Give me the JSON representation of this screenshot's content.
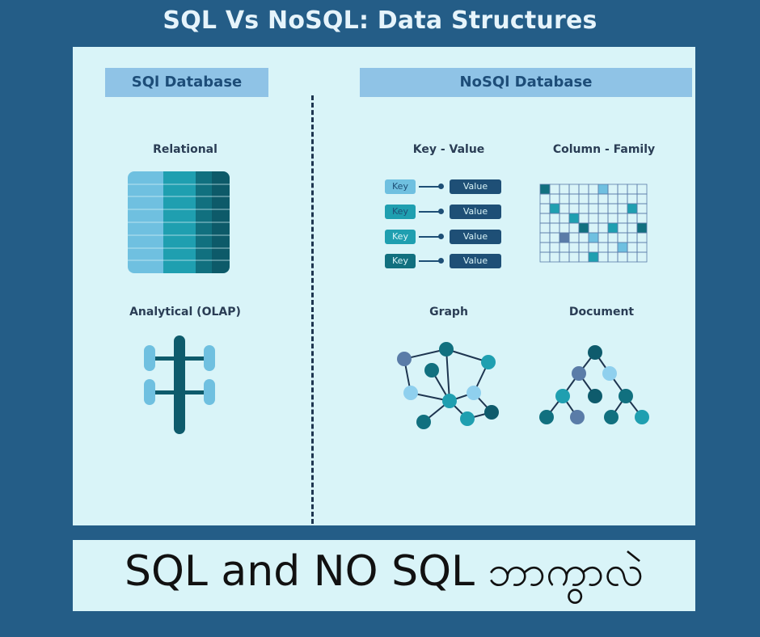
{
  "title": "SQL Vs NoSQL: Data Structures",
  "sql_header": "SQl Database",
  "nosql_header": "NoSQl Database",
  "labels": {
    "relational": "Relational",
    "olap": "Analytical (OLAP)",
    "key_value": "Key - Value",
    "column_family": "Column - Family",
    "graph": "Graph",
    "document": "Document"
  },
  "kv_rows": [
    {
      "key": "Key",
      "value": "Value"
    },
    {
      "key": "Key",
      "value": "Value"
    },
    {
      "key": "Key",
      "value": "Value"
    },
    {
      "key": "Key",
      "value": "Value"
    }
  ],
  "footer": "SQL and NO SQL ဘာကွာလဲ",
  "colors": {
    "background": "#245d87",
    "panel": "#d9f4f8",
    "header": "#8fc3e6",
    "light_blue": "#6fc0e0",
    "teal": "#1f9fb0",
    "dark_teal": "#11707f",
    "navy": "#1e4f76",
    "slate": "#5a7ca8"
  }
}
